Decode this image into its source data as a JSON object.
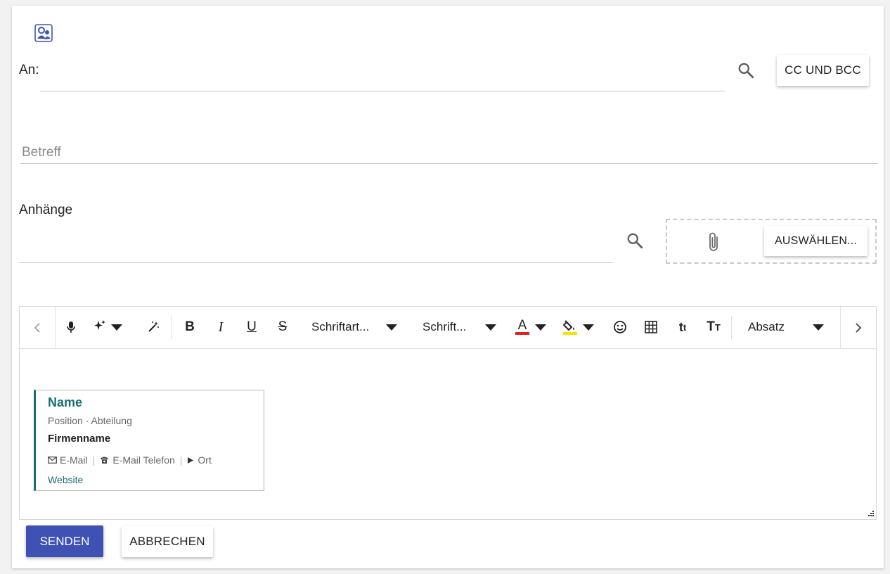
{
  "compose": {
    "to_label": "An:",
    "cc_bcc_label": "CC UND BCC",
    "subject_placeholder": "Betreff",
    "attachments_label": "Anhänge",
    "choose_label": "AUSWÄHLEN..."
  },
  "toolbar": {
    "icons": [
      "chevron-left-icon",
      "microphone-icon",
      "sparkle-icon",
      "magic-wand-icon",
      "bold-icon",
      "italic-icon",
      "underline-icon",
      "strikethrough-icon",
      "text-color-icon",
      "highlight-icon",
      "emoji-icon",
      "table-icon",
      "superscript-icon",
      "font-case-icon",
      "chevron-right-icon"
    ],
    "font_family": "Schriftart...",
    "font_size": "Schrift...",
    "paragraph": "Absatz",
    "text_color": "#e02020",
    "highlight_color": "#f5e400"
  },
  "signature": {
    "name": "Name",
    "position": "Position · Abteilung",
    "company": "Firmenname",
    "email": "E-Mail",
    "phone": "E-Mail Telefon",
    "location": "Ort",
    "website": "Website",
    "accent_color": "#1a6e73"
  },
  "actions": {
    "send_label": "SENDEN",
    "cancel_label": "ABBRECHEN",
    "send_color": "#3f51b5"
  }
}
